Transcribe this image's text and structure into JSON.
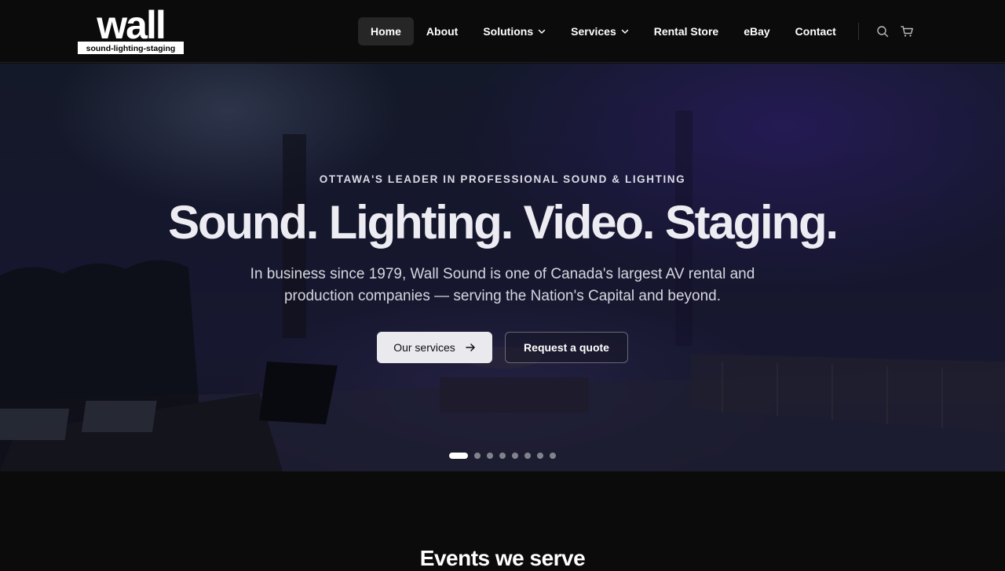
{
  "header": {
    "logo": {
      "word": "wall",
      "tagline": "sound-lighting-staging"
    },
    "nav": [
      {
        "label": "Home",
        "active": true,
        "dropdown": false
      },
      {
        "label": "About",
        "active": false,
        "dropdown": false
      },
      {
        "label": "Solutions",
        "active": false,
        "dropdown": true
      },
      {
        "label": "Services",
        "active": false,
        "dropdown": true
      },
      {
        "label": "Rental Store",
        "active": false,
        "dropdown": false
      },
      {
        "label": "eBay",
        "active": false,
        "dropdown": false
      },
      {
        "label": "Contact",
        "active": false,
        "dropdown": false
      }
    ],
    "icons": [
      "search-icon",
      "cart-icon"
    ]
  },
  "hero": {
    "eyebrow": "OTTAWA'S LEADER IN PROFESSIONAL SOUND & LIGHTING",
    "headline": "Sound. Lighting. Video. Staging.",
    "subtext": "In business since 1979, Wall Sound is one of Canada's largest AV rental and production companies — serving the Nation's Capital and beyond.",
    "primary_button": "Our services",
    "secondary_button": "Request a quote",
    "slides": {
      "count": 8,
      "active": 1
    }
  },
  "events": {
    "title": "Events we serve"
  },
  "colors": {
    "background": "#0b0b0b",
    "nav_active": "#262626",
    "primary_button": "#e9e9ee",
    "hero_tint": "#20203f"
  }
}
